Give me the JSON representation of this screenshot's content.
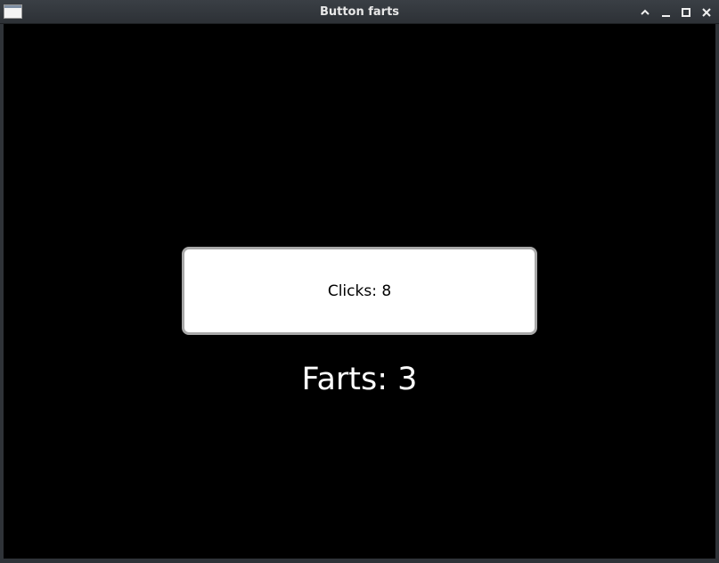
{
  "window": {
    "title": "Button farts",
    "controls": [
      "chevron-up-icon",
      "minimize-icon",
      "maximize-icon",
      "close-icon"
    ]
  },
  "main": {
    "button_label": "Clicks: 8",
    "clicks": 8,
    "counter_label": "Farts: 3",
    "farts": 3
  },
  "colors": {
    "background": "#000000",
    "button_bg": "#ffffff",
    "button_border": "#a9a9a9",
    "text_on_dark": "#ffffff"
  }
}
